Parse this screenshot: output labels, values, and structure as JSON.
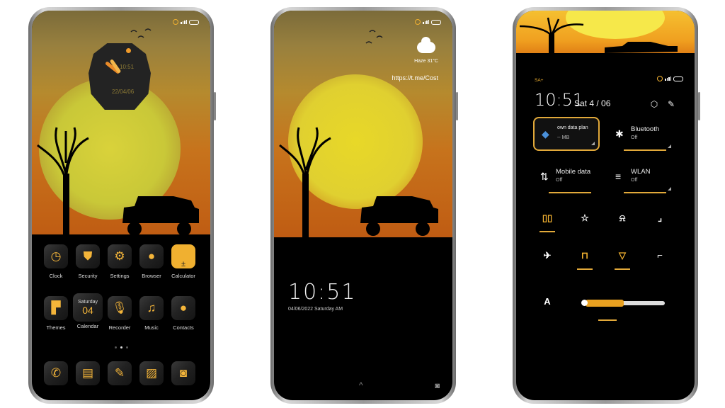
{
  "colors": {
    "accent": "#f0b030",
    "sky_top": "#7b6b3a",
    "sky_bottom": "#bf5a12",
    "sun": "#d9d23a",
    "background": "#000000"
  },
  "home": {
    "clock_widget": {
      "time": "10:51",
      "date": "22/04/06"
    },
    "apps_row1": [
      {
        "label": "Clock",
        "icon": "clock-icon",
        "glyph": "◷"
      },
      {
        "label": "Security",
        "icon": "shield-icon",
        "glyph": "⛊"
      },
      {
        "label": "Settings",
        "icon": "gear-icon",
        "glyph": "⚙"
      },
      {
        "label": "Browser",
        "icon": "planet-icon",
        "glyph": "●"
      },
      {
        "label": "Calculator",
        "icon": "calculator-icon",
        "glyph": "± "
      }
    ],
    "apps_row2": [
      {
        "label": "Themes",
        "icon": "paint-roller-icon",
        "glyph": "▛"
      },
      {
        "label": "Calendar",
        "icon": "calendar-icon",
        "glyph": "",
        "day": "Saturday",
        "date": "04"
      },
      {
        "label": "Recorder",
        "icon": "microphone-icon",
        "glyph": "🎙"
      },
      {
        "label": "Music",
        "icon": "music-note-icon",
        "glyph": "♫"
      },
      {
        "label": "Contacts",
        "icon": "person-icon",
        "glyph": "●"
      }
    ],
    "page_indicator": {
      "count": 3,
      "active": 1
    },
    "dock": [
      {
        "icon": "phone-icon",
        "glyph": "✆"
      },
      {
        "icon": "message-icon",
        "glyph": "▤"
      },
      {
        "icon": "notes-pen-icon",
        "glyph": "✎"
      },
      {
        "icon": "gallery-icon",
        "glyph": "▨"
      },
      {
        "icon": "camera-icon",
        "glyph": "◙"
      }
    ]
  },
  "lock": {
    "weather": "Haze 31°C",
    "url": "https://t.me/Cost",
    "time": "10:51",
    "date": "04/06/2022 Saturday AM",
    "swipe_up": "^",
    "camera": "◙"
  },
  "control_center": {
    "carrier": "SA+",
    "time": "10:51",
    "date": "Sat 4 / 06",
    "tiles": [
      {
        "title": "own data plan",
        "sub": "-- MB",
        "icon": "water-drop-icon",
        "glyph": "💧",
        "highlighted": true
      },
      {
        "title": "Bluetooth",
        "sub": "Off",
        "icon": "bluetooth-icon",
        "glyph": "✱"
      },
      {
        "title": "Mobile data",
        "sub": "Off",
        "icon": "mobile-data-icon",
        "glyph": "⇅"
      },
      {
        "title": "WLAN",
        "sub": "Off",
        "icon": "wifi-icon",
        "glyph": "≡"
      }
    ],
    "toggles_row1": [
      {
        "icon": "vibrate-icon",
        "glyph": "▯▯",
        "on": true
      },
      {
        "icon": "flashlight-icon",
        "glyph": "☆",
        "on": false
      },
      {
        "icon": "notification-bell-icon",
        "glyph": "⍾",
        "on": false
      },
      {
        "icon": "screenshot-icon",
        "glyph": "⌟",
        "on": false
      }
    ],
    "toggles_row2": [
      {
        "icon": "airplane-icon",
        "glyph": "✈",
        "on": false
      },
      {
        "icon": "cast-icon",
        "glyph": "⊓",
        "on": true
      },
      {
        "icon": "location-icon",
        "glyph": "▽",
        "on": true
      },
      {
        "icon": "rotation-lock-icon",
        "glyph": "⌐",
        "on": false
      }
    ],
    "auto_brightness": "A",
    "brightness_percent": 48
  }
}
